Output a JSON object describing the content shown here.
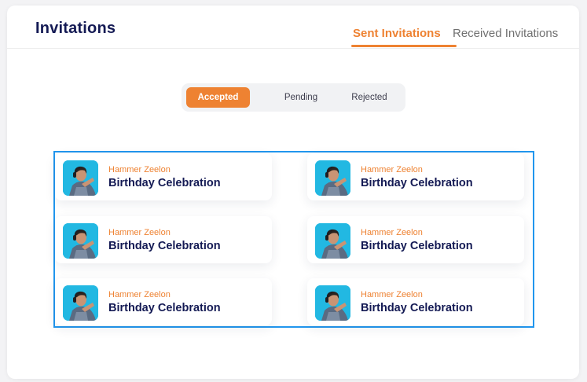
{
  "header": {
    "title": "Invitations",
    "tabs": [
      {
        "label": "Sent Invitations",
        "active": true
      },
      {
        "label": "Received Invitations",
        "active": false
      }
    ]
  },
  "filters": {
    "options": [
      {
        "label": "Accepted",
        "active": true
      },
      {
        "label": "Pending",
        "active": false
      },
      {
        "label": "Rejected",
        "active": false
      }
    ]
  },
  "invitations": [
    {
      "host": "Hammer Zeelon",
      "event": "Birthday Celebration"
    },
    {
      "host": "Hammer Zeelon",
      "event": "Birthday Celebration"
    },
    {
      "host": "Hammer Zeelon",
      "event": "Birthday Celebration"
    },
    {
      "host": "Hammer Zeelon",
      "event": "Birthday Celebration"
    },
    {
      "host": "Hammer Zeelon",
      "event": "Birthday Celebration"
    },
    {
      "host": "Hammer Zeelon",
      "event": "Birthday Celebration"
    }
  ],
  "colors": {
    "accent": "#ee8232",
    "heading": "#141a54",
    "selection_border": "#2196ee"
  }
}
